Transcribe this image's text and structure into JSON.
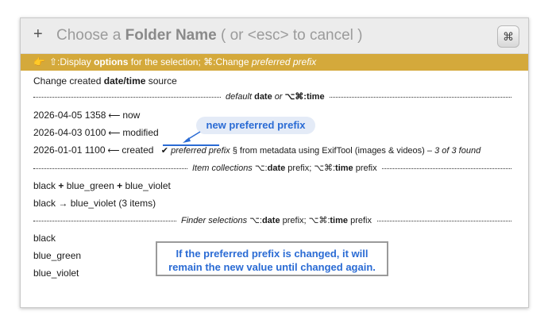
{
  "header": {
    "plus": "+",
    "prompt_pre": "Choose a ",
    "prompt_bold": "Folder Name",
    "prompt_post": " ( or <esc> to cancel )",
    "app_icon": "⌘"
  },
  "banner": {
    "hand": "👉",
    "t1": "⇧:Display ",
    "t2": "options",
    "t3": " for the selection; ⌘:Change ",
    "t4": "preferred prefix"
  },
  "heading": {
    "pre": "Change created ",
    "bold": "date/time",
    "post": " source"
  },
  "sep1": {
    "pre": "default ",
    "bold": "date",
    "mid": " or ",
    "bold2": "⌥⌘:time"
  },
  "date_rows": [
    {
      "date": "2026-04-05 1358",
      "arrow": " ⟵ ",
      "label": "now"
    },
    {
      "date": "2026-04-03 0100",
      "arrow": " ⟵ ",
      "label": "modified"
    },
    {
      "date": "2026-01-01 1100",
      "arrow": " ⟵ ",
      "label": "created"
    }
  ],
  "created_extra": {
    "check": "✔",
    "pref": " preferred prefix",
    "rest": "  § from metadata using ExifTool (images & videos) – ",
    "count": "3 of 3 found"
  },
  "sep2": {
    "pre": "Item collections  ",
    "k1": "⌥:",
    "b1": "date",
    "m1": " prefix; ",
    "k2": "⌥⌘:",
    "b2": "time",
    "m2": " prefix"
  },
  "collections": [
    {
      "a": "black",
      "op1": " + ",
      "b": "blue_green",
      "op2": " + ",
      "c": "blue_violet"
    },
    {
      "a": "black",
      "op1": " → ",
      "b": "blue_violet (3 items)",
      "op2": "",
      "c": ""
    }
  ],
  "sep3": {
    "pre": "Finder selections  ",
    "k1": "⌥:",
    "b1": "date",
    "m1": " prefix; ",
    "k2": "⌥⌘:",
    "b2": "time",
    "m2": " prefix"
  },
  "finder": [
    "black",
    "blue_green",
    "blue_violet"
  ],
  "callout": "new preferred prefix",
  "note": {
    "line1": "If the preferred prefix is changed, it will",
    "line2": "remain the new value until changed again."
  }
}
